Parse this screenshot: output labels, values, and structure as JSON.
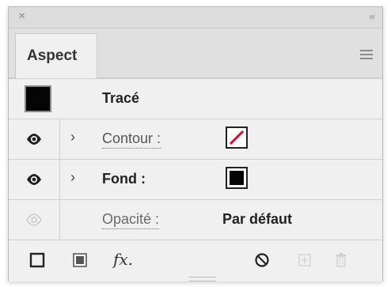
{
  "titlebar": {
    "close_symbol": "×",
    "collapse_symbol": "‹‹"
  },
  "panel": {
    "tab_label": "Aspect"
  },
  "rows": {
    "header": {
      "title": "Tracé"
    },
    "stroke": {
      "label": "Contour :",
      "chevron": "›",
      "swatch_color": "#ffffff",
      "slash_color": "#c8102e"
    },
    "fill": {
      "label": "Fond :",
      "chevron": "›",
      "swatch_color": "#050505"
    },
    "opacity": {
      "label": "Opacité :",
      "value": "Par défaut"
    }
  },
  "footer": {
    "fx_label": "fx."
  },
  "icons": [
    "close-icon",
    "collapse-icon",
    "panel-menu-icon",
    "eye-icon",
    "chevron-right-icon",
    "new-stroke-icon",
    "new-fill-icon",
    "fx-icon",
    "clear-appearance-icon",
    "duplicate-icon",
    "delete-icon"
  ]
}
